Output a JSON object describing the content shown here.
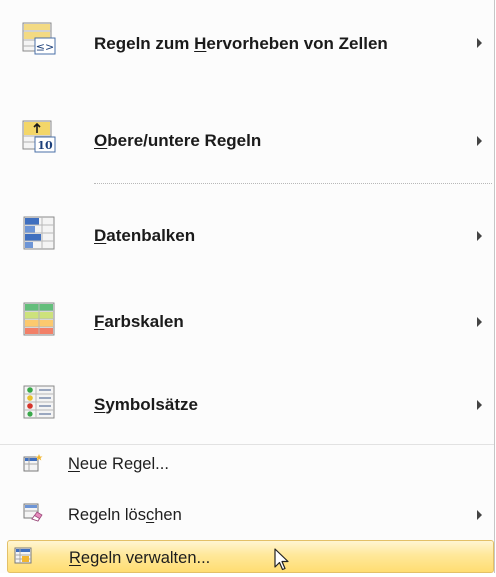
{
  "menu": {
    "items": [
      {
        "pre": "Regeln zum ",
        "u": "H",
        "post": "ervorheben von Zellen",
        "icon": "highlight-cells-rules-icon",
        "submenu": true
      },
      {
        "pre": "",
        "u": "O",
        "post": "bere/untere Regeln",
        "icon": "top-bottom-rules-icon",
        "submenu": true
      },
      {
        "pre": "",
        "u": "D",
        "post": "atenbalken",
        "icon": "data-bars-icon",
        "submenu": true
      },
      {
        "pre": "",
        "u": "F",
        "post": "arbskalen",
        "icon": "color-scales-icon",
        "submenu": true
      },
      {
        "pre": "",
        "u": "S",
        "post": "ymbolsätze",
        "icon": "icon-sets-icon",
        "submenu": true
      },
      {
        "pre": "",
        "u": "N",
        "post": "eue Regel...",
        "icon": "new-rule-icon",
        "submenu": false
      },
      {
        "pre": "Regeln lös",
        "u": "c",
        "post": "hen",
        "icon": "clear-rules-icon",
        "submenu": true
      },
      {
        "pre": "",
        "u": "R",
        "post": "egeln verwalten...",
        "icon": "manage-rules-icon",
        "submenu": false,
        "highlighted": true
      }
    ]
  }
}
